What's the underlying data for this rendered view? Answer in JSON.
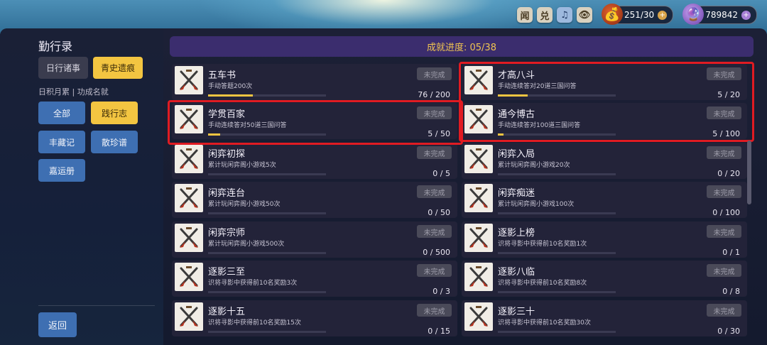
{
  "topbar": {
    "buttons": [
      {
        "label": "闻",
        "icon": "news-icon"
      },
      {
        "label": "兑",
        "icon": "exchange-icon"
      },
      {
        "label": "♫",
        "icon": "music-icon"
      },
      {
        "label": "👁",
        "icon": "eye-icon"
      }
    ],
    "stamina": {
      "value": "251/30",
      "icon": "money-bag-icon"
    },
    "currency": {
      "value": "789842",
      "icon": "purple-gem-icon"
    }
  },
  "sidebar": {
    "title": "勤行录",
    "tabs": [
      {
        "label": "日行诸事",
        "active": false
      },
      {
        "label": "青史遗痕",
        "active": true
      }
    ],
    "subtitle": "日积月累 | 功成名就",
    "categories": [
      {
        "label": "全部",
        "active": false
      },
      {
        "label": "践行志",
        "active": true
      },
      {
        "label": "丰藏记",
        "active": false
      },
      {
        "label": "散珍谱",
        "active": false
      },
      {
        "label": "嘉运册",
        "active": false
      }
    ],
    "back_label": "返回"
  },
  "main": {
    "progress_label": "成就进度: 05/38",
    "achievements": [
      {
        "name": "五车书",
        "desc": "手动答题200次",
        "status": "未完成",
        "progress": "76 / 200",
        "fraction": 0.38
      },
      {
        "name": "才高八斗",
        "desc": "手动连续答对20道三国问答",
        "status": "未完成",
        "progress": "5 / 20",
        "fraction": 0.25,
        "highlighted": true
      },
      {
        "name": "学贯百家",
        "desc": "手动连续答对50道三国问答",
        "status": "未完成",
        "progress": "5 / 50",
        "fraction": 0.1,
        "highlighted": true
      },
      {
        "name": "通今博古",
        "desc": "手动连续答对100道三国问答",
        "status": "未完成",
        "progress": "5 / 100",
        "fraction": 0.05,
        "highlighted": true
      },
      {
        "name": "闲弈初探",
        "desc": "累计玩闲弈阁小游戏5次",
        "status": "未完成",
        "progress": "0 / 5",
        "fraction": 0
      },
      {
        "name": "闲弈入局",
        "desc": "累计玩闲弈阁小游戏20次",
        "status": "未完成",
        "progress": "0 / 20",
        "fraction": 0
      },
      {
        "name": "闲弈连台",
        "desc": "累计玩闲弈阁小游戏50次",
        "status": "未完成",
        "progress": "0 / 50",
        "fraction": 0
      },
      {
        "name": "闲弈痴迷",
        "desc": "累计玩闲弈阁小游戏100次",
        "status": "未完成",
        "progress": "0 / 100",
        "fraction": 0
      },
      {
        "name": "闲弈宗师",
        "desc": "累计玩闲弈阁小游戏500次",
        "status": "未完成",
        "progress": "0 / 500",
        "fraction": 0
      },
      {
        "name": "逐影上榜",
        "desc": "识将寻影中获得前10名奖励1次",
        "status": "未完成",
        "progress": "0 / 1",
        "fraction": 0
      },
      {
        "name": "逐影三至",
        "desc": "识将寻影中获得前10名奖励3次",
        "status": "未完成",
        "progress": "0 / 3",
        "fraction": 0
      },
      {
        "name": "逐影八临",
        "desc": "识将寻影中获得前10名奖励8次",
        "status": "未完成",
        "progress": "0 / 8",
        "fraction": 0
      },
      {
        "name": "逐影十五",
        "desc": "识将寻影中获得前10名奖励15次",
        "status": "未完成",
        "progress": "0 / 15",
        "fraction": 0
      },
      {
        "name": "逐影三十",
        "desc": "识将寻影中获得前10名奖励30次",
        "status": "未完成",
        "progress": "0 / 30",
        "fraction": 0
      }
    ],
    "achievement_icon": "crossed-brushes-icon",
    "highlight_color": "#e01b22",
    "accent_color": "#f3c541"
  }
}
